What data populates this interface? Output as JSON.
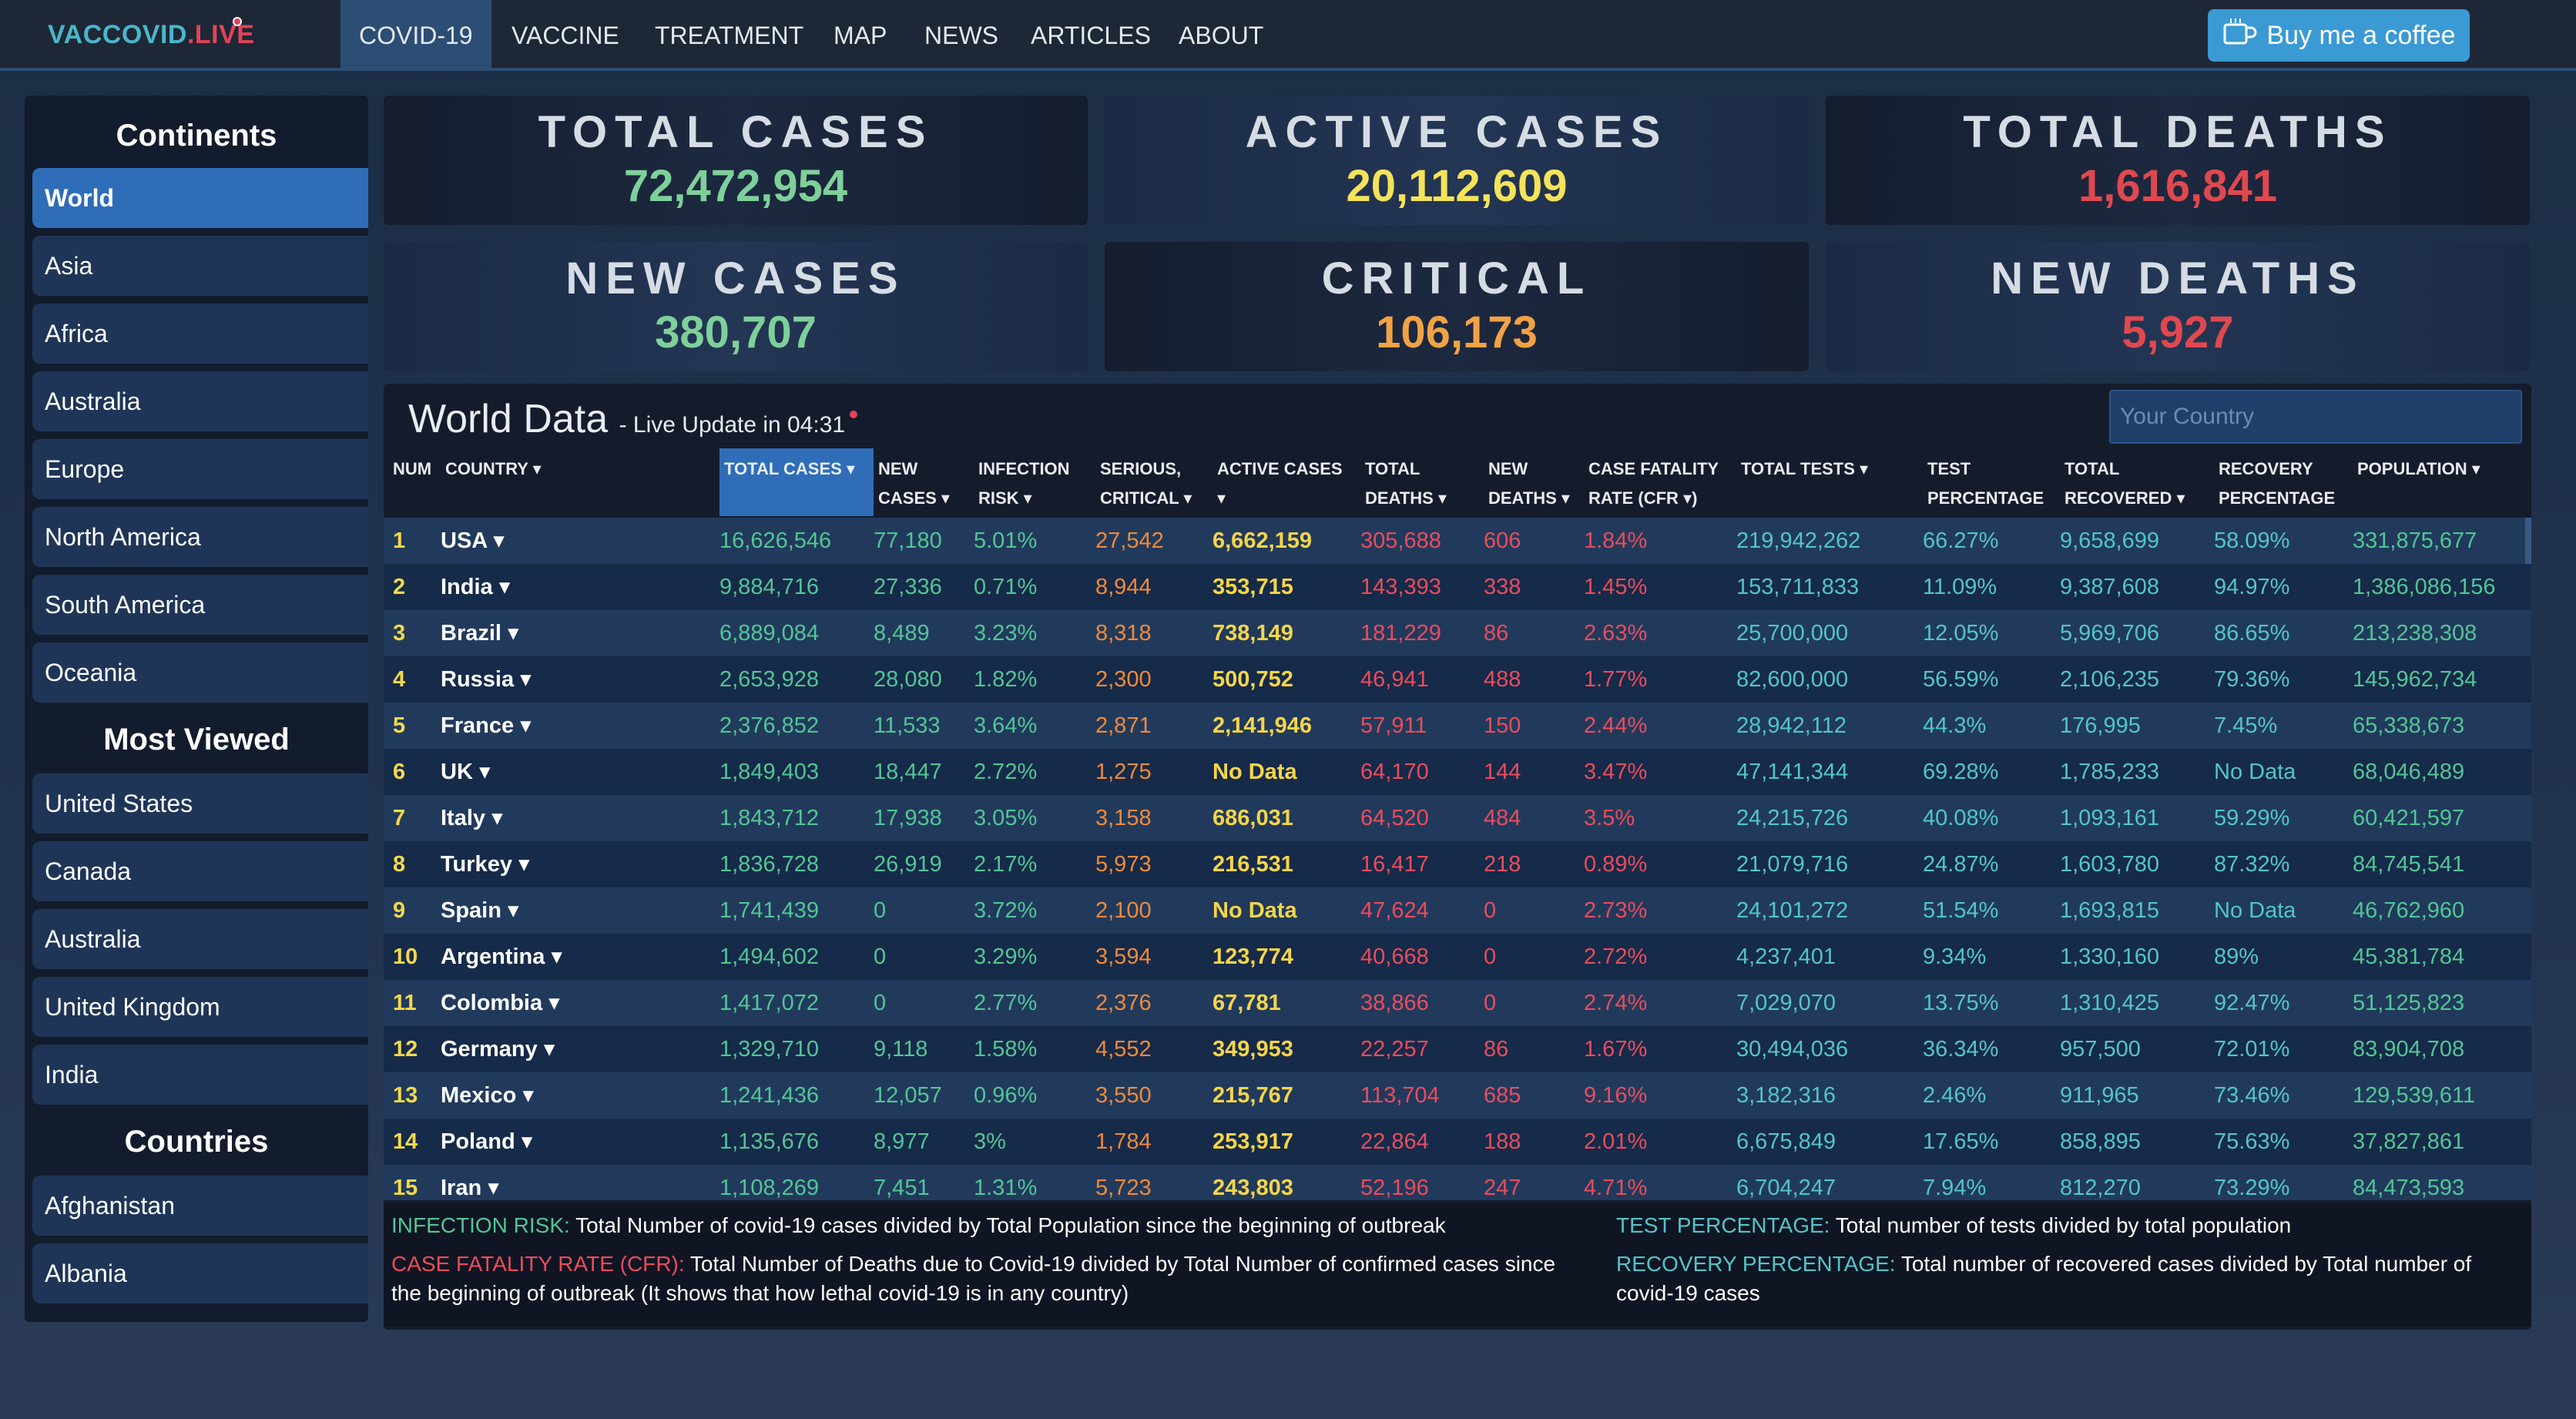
{
  "brand": {
    "part1": "VACCOVID",
    "part2": ".LIVE"
  },
  "nav": [
    {
      "label": "COVID-19",
      "active": true
    },
    {
      "label": "VACCINE"
    },
    {
      "label": "TREATMENT"
    },
    {
      "label": "MAP"
    },
    {
      "label": "NEWS"
    },
    {
      "label": "ARTICLES"
    },
    {
      "label": "ABOUT"
    }
  ],
  "coffee_button": {
    "label": "Buy me a coffee",
    "icon": "coffee-cup-icon"
  },
  "sidebar": {
    "continents_heading": "Continents",
    "continents": [
      "World",
      "Asia",
      "Africa",
      "Australia",
      "Europe",
      "North America",
      "South America",
      "Oceania"
    ],
    "most_viewed_heading": "Most Viewed",
    "most_viewed": [
      "United States",
      "Canada",
      "Australia",
      "United Kingdom",
      "India"
    ],
    "countries_heading": "Countries",
    "countries": [
      "Afghanistan",
      "Albania"
    ]
  },
  "stats": {
    "total_cases": {
      "label": "TOTAL CASES",
      "value": "72,472,954",
      "color": "#7ed09a"
    },
    "active_cases": {
      "label": "ACTIVE CASES",
      "value": "20,112,609",
      "color": "#f4e35a"
    },
    "total_deaths": {
      "label": "TOTAL DEATHS",
      "value": "1,616,841",
      "color": "#e0484f"
    },
    "new_cases": {
      "label": "NEW CASES",
      "value": "380,707",
      "color": "#7ed09a"
    },
    "critical": {
      "label": "CRITICAL",
      "value": "106,173",
      "color": "#f2a245"
    },
    "new_deaths": {
      "label": "NEW DEATHS",
      "value": "5,927",
      "color": "#e0484f"
    }
  },
  "table": {
    "title": "World Data",
    "subtitle": "- Live Update in 04:31",
    "search_placeholder": "Your Country",
    "headers": {
      "num": "NUM",
      "country": "COUNTRY ▾",
      "total_cases": "TOTAL CASES ▾",
      "new_cases_1": "NEW",
      "new_cases_2": "CASES ▾",
      "inf_1": "INFECTION",
      "inf_2": "RISK ▾",
      "ser_1": "SERIOUS,",
      "ser_2": "CRITICAL ▾",
      "active": "ACTIVE CASES ▾",
      "td_1": "TOTAL",
      "td_2": "DEATHS ▾",
      "nd_1": "NEW",
      "nd_2": "DEATHS ▾",
      "cfr_1": "CASE FATALITY",
      "cfr_2": "RATE (CFR ▾)",
      "tests": "TOTAL TESTS ▾",
      "tp_1": "TEST",
      "tp_2": "PERCENTAGE ▾",
      "tr_1": "TOTAL",
      "tr_2": "RECOVERED ▾",
      "rp_1": "RECOVERY",
      "rp_2": "PERCENTAGE ▾",
      "pop": "POPULATION ▾"
    },
    "rows": [
      [
        "1",
        "USA ▾",
        "16,626,546",
        "77,180",
        "5.01%",
        "27,542",
        "6,662,159",
        "305,688",
        "606",
        "1.84%",
        "219,942,262",
        "66.27%",
        "9,658,699",
        "58.09%",
        "331,875,677"
      ],
      [
        "2",
        "India ▾",
        "9,884,716",
        "27,336",
        "0.71%",
        "8,944",
        "353,715",
        "143,393",
        "338",
        "1.45%",
        "153,711,833",
        "11.09%",
        "9,387,608",
        "94.97%",
        "1,386,086,156"
      ],
      [
        "3",
        "Brazil ▾",
        "6,889,084",
        "8,489",
        "3.23%",
        "8,318",
        "738,149",
        "181,229",
        "86",
        "2.63%",
        "25,700,000",
        "12.05%",
        "5,969,706",
        "86.65%",
        "213,238,308"
      ],
      [
        "4",
        "Russia ▾",
        "2,653,928",
        "28,080",
        "1.82%",
        "2,300",
        "500,752",
        "46,941",
        "488",
        "1.77%",
        "82,600,000",
        "56.59%",
        "2,106,235",
        "79.36%",
        "145,962,734"
      ],
      [
        "5",
        "France ▾",
        "2,376,852",
        "11,533",
        "3.64%",
        "2,871",
        "2,141,946",
        "57,911",
        "150",
        "2.44%",
        "28,942,112",
        "44.3%",
        "176,995",
        "7.45%",
        "65,338,673"
      ],
      [
        "6",
        "UK ▾",
        "1,849,403",
        "18,447",
        "2.72%",
        "1,275",
        "No Data",
        "64,170",
        "144",
        "3.47%",
        "47,141,344",
        "69.28%",
        "1,785,233",
        "No Data",
        "68,046,489"
      ],
      [
        "7",
        "Italy ▾",
        "1,843,712",
        "17,938",
        "3.05%",
        "3,158",
        "686,031",
        "64,520",
        "484",
        "3.5%",
        "24,215,726",
        "40.08%",
        "1,093,161",
        "59.29%",
        "60,421,597"
      ],
      [
        "8",
        "Turkey ▾",
        "1,836,728",
        "26,919",
        "2.17%",
        "5,973",
        "216,531",
        "16,417",
        "218",
        "0.89%",
        "21,079,716",
        "24.87%",
        "1,603,780",
        "87.32%",
        "84,745,541"
      ],
      [
        "9",
        "Spain ▾",
        "1,741,439",
        "0",
        "3.72%",
        "2,100",
        "No Data",
        "47,624",
        "0",
        "2.73%",
        "24,101,272",
        "51.54%",
        "1,693,815",
        "No Data",
        "46,762,960"
      ],
      [
        "10",
        "Argentina ▾",
        "1,494,602",
        "0",
        "3.29%",
        "3,594",
        "123,774",
        "40,668",
        "0",
        "2.72%",
        "4,237,401",
        "9.34%",
        "1,330,160",
        "89%",
        "45,381,784"
      ],
      [
        "11",
        "Colombia ▾",
        "1,417,072",
        "0",
        "2.77%",
        "2,376",
        "67,781",
        "38,866",
        "0",
        "2.74%",
        "7,029,070",
        "13.75%",
        "1,310,425",
        "92.47%",
        "51,125,823"
      ],
      [
        "12",
        "Germany ▾",
        "1,329,710",
        "9,118",
        "1.58%",
        "4,552",
        "349,953",
        "22,257",
        "86",
        "1.67%",
        "30,494,036",
        "36.34%",
        "957,500",
        "72.01%",
        "83,904,708"
      ],
      [
        "13",
        "Mexico ▾",
        "1,241,436",
        "12,057",
        "0.96%",
        "3,550",
        "215,767",
        "113,704",
        "685",
        "9.16%",
        "3,182,316",
        "2.46%",
        "911,965",
        "73.46%",
        "129,539,611"
      ],
      [
        "14",
        "Poland ▾",
        "1,135,676",
        "8,977",
        "3%",
        "1,784",
        "253,917",
        "22,864",
        "188",
        "2.01%",
        "6,675,849",
        "17.65%",
        "858,895",
        "75.63%",
        "37,827,861"
      ],
      [
        "15",
        "Iran ▾",
        "1,108,269",
        "7,451",
        "1.31%",
        "5,723",
        "243,803",
        "52,196",
        "247",
        "4.71%",
        "6,704,247",
        "7.94%",
        "812,270",
        "73.29%",
        "84,473,593"
      ]
    ]
  },
  "legend": {
    "inf_key": "INFECTION RISK:",
    "inf_text": "Total Number of covid-19 cases divided by Total Population since the beginning of outbreak",
    "cfr_key": "CASE FATALITY RATE (CFR):",
    "cfr_text_1": "Total Number of Deaths due to Covid-19 divided by Total Number of confirmed cases since",
    "cfr_text_2": "the beginning of outbreak (It shows that how lethal covid-19 is in any country)",
    "tp_key": "TEST PERCENTAGE:",
    "tp_text": "Total number of tests divided by total population",
    "rp_key": "RECOVERY PERCENTAGE:",
    "rp_text_1": "Total number of recovered cases divided by Total number of",
    "rp_text_2": "covid-19 cases"
  }
}
